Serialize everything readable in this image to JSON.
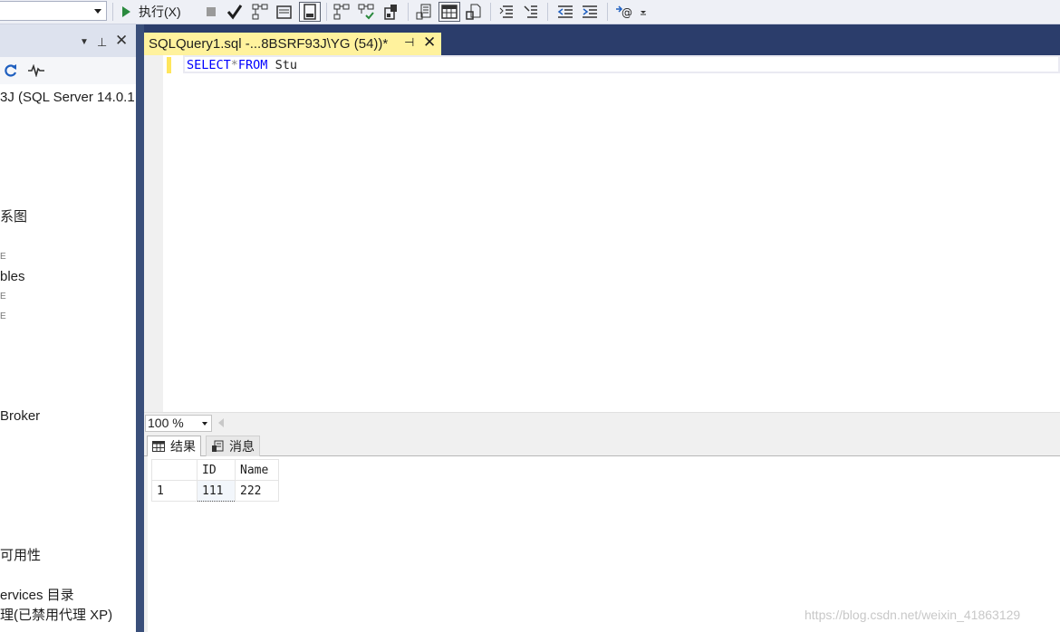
{
  "toolbar": {
    "database_value": "",
    "execute_label": "执行(X)",
    "icons": [
      "play-icon",
      "stop-icon",
      "parse-check-icon",
      "display-plan-icon",
      "query-in-editor-icon",
      "results-to-file-icon",
      "include-plan-icon",
      "live-stats-icon",
      "client-stats-icon",
      "results-to-text-icon",
      "results-to-grid-icon",
      "results-to-file-icon",
      "comment-icon",
      "uncomment-icon",
      "decrease-indent-icon",
      "increase-indent-icon",
      "specify-template-values-icon"
    ]
  },
  "object_explorer": {
    "items": [
      {
        "label": "3J (SQL Server 14.0.1"
      },
      {
        "label": "系图"
      },
      {
        "label": "E"
      },
      {
        "label": "bles"
      },
      {
        "label": "E"
      },
      {
        "label": "E"
      },
      {
        "label": "Broker"
      },
      {
        "label": "可用性"
      },
      {
        "label": "ervices 目录"
      },
      {
        "label": "理(已禁用代理 XP)"
      }
    ]
  },
  "document_tab": {
    "title": "SQLQuery1.sql -...8BSRF93J\\YG (54))*"
  },
  "editor": {
    "tokens": [
      {
        "text": "SELECT",
        "kind": "keyword"
      },
      {
        "text": "*",
        "kind": "operator"
      },
      {
        "text": "FROM",
        "kind": "keyword"
      },
      {
        "text": " Stu",
        "kind": "identifier"
      }
    ]
  },
  "zoom": {
    "value": "100 %"
  },
  "result_tabs": [
    {
      "label": "结果",
      "active": true
    },
    {
      "label": "消息",
      "active": false
    }
  ],
  "results": {
    "columns": [
      "ID",
      "Name"
    ],
    "rows": [
      {
        "row_number": "1",
        "cells": [
          "111",
          "222"
        ]
      }
    ]
  },
  "watermark": "https://blog.csdn.net/weixin_41863129",
  "colors": {
    "tab_active": "#fff29d",
    "tabstrip": "#2b3d6b",
    "keyword": "#0000ff",
    "operator": "#808080",
    "change_bar": "#ffe65c"
  }
}
